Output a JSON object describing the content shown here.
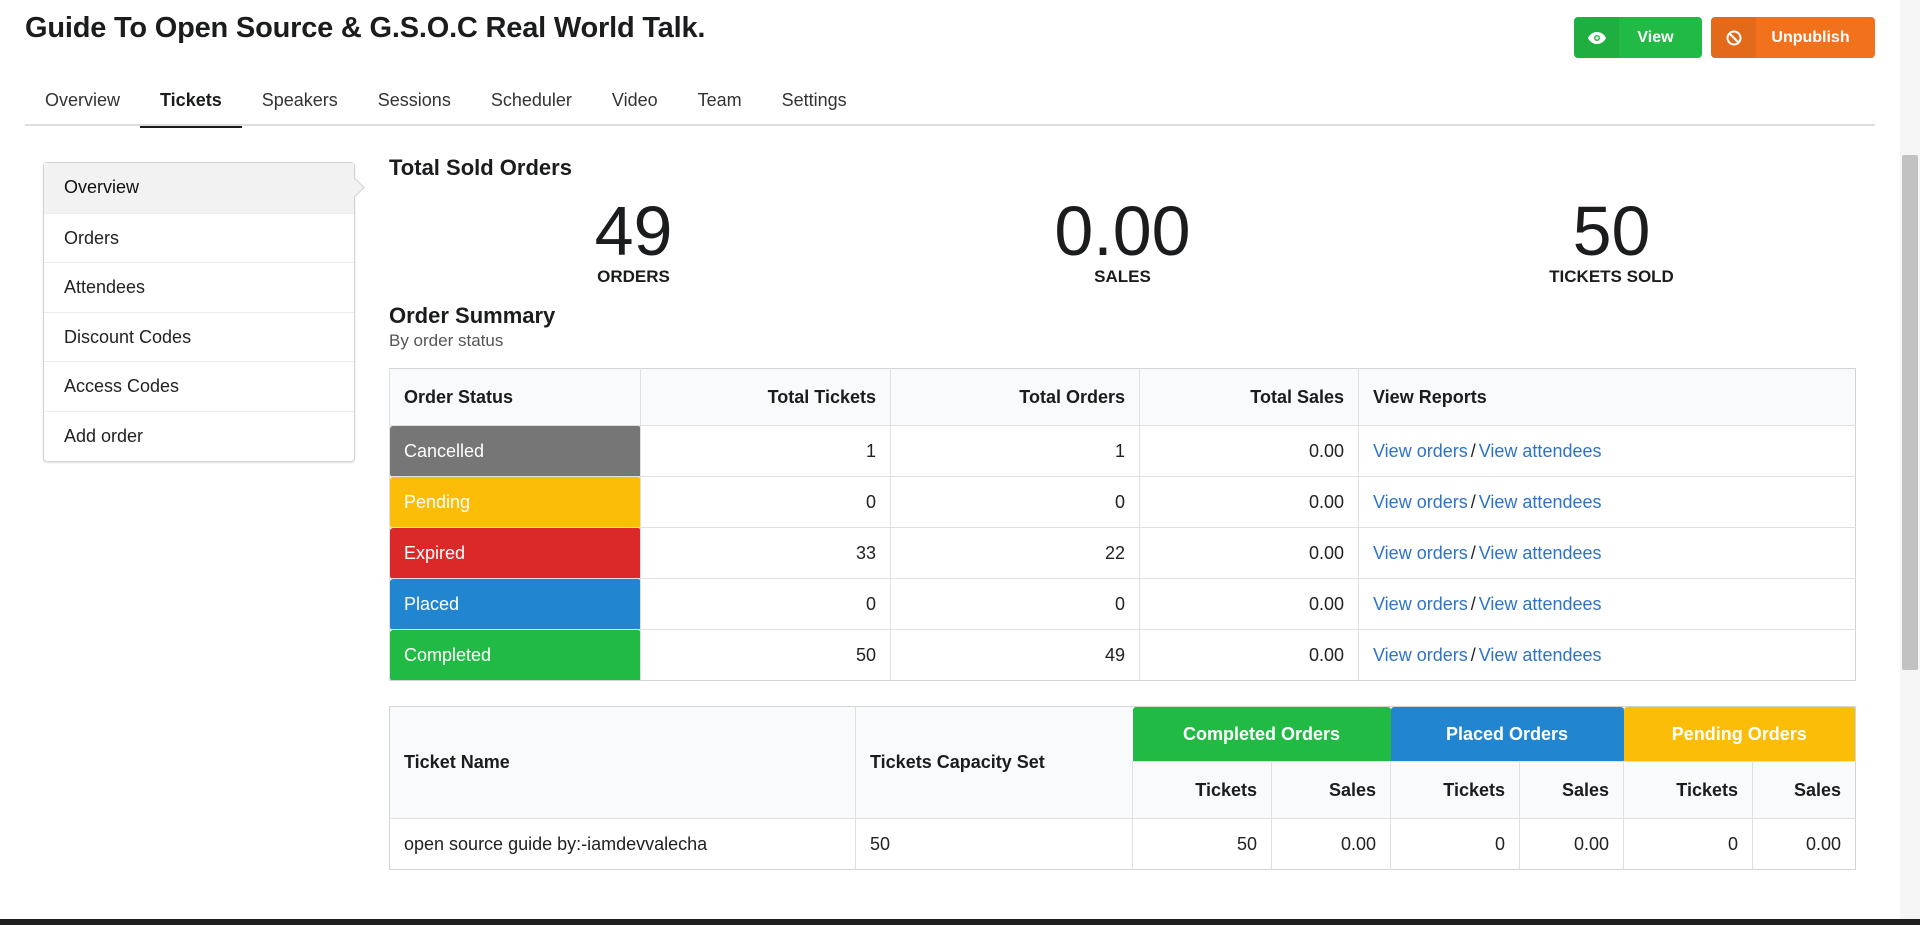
{
  "event_title": "Guide To Open Source & G.S.O.C Real World Talk.",
  "actions": {
    "view_label": "View",
    "unpublish_label": "Unpublish"
  },
  "tabs": [
    "Overview",
    "Tickets",
    "Speakers",
    "Sessions",
    "Scheduler",
    "Video",
    "Team",
    "Settings"
  ],
  "active_tab": "Tickets",
  "side_menu": [
    "Overview",
    "Orders",
    "Attendees",
    "Discount Codes",
    "Access Codes",
    "Add order"
  ],
  "sold": {
    "title": "Total Sold Orders",
    "stats": [
      {
        "value": "49",
        "label": "ORDERS"
      },
      {
        "value": "0.00",
        "label": "SALES"
      },
      {
        "value": "50",
        "label": "TICKETS SOLD"
      }
    ]
  },
  "summary": {
    "title": "Order Summary",
    "subtitle": "By order status",
    "headers": [
      "Order Status",
      "Total Tickets",
      "Total Orders",
      "Total Sales",
      "View Reports"
    ],
    "view_orders": "View orders",
    "separator": "/",
    "view_attendees": "View attendees",
    "rows": [
      {
        "status": "Cancelled",
        "color": "#767676",
        "tickets": "1",
        "orders": "1",
        "sales": "0.00"
      },
      {
        "status": "Pending",
        "color": "#fbbd08",
        "tickets": "0",
        "orders": "0",
        "sales": "0.00"
      },
      {
        "status": "Expired",
        "color": "#db2828",
        "tickets": "33",
        "orders": "22",
        "sales": "0.00"
      },
      {
        "status": "Placed",
        "color": "#2185d0",
        "tickets": "0",
        "orders": "0",
        "sales": "0.00"
      },
      {
        "status": "Completed",
        "color": "#21ba45",
        "tickets": "50",
        "orders": "49",
        "sales": "0.00"
      }
    ]
  },
  "tickets_table": {
    "ticket_name_header": "Ticket Name",
    "capacity_header": "Tickets Capacity Set",
    "groups": [
      {
        "label": "Completed Orders",
        "color": "#21ba45"
      },
      {
        "label": "Placed Orders",
        "color": "#2185d0"
      },
      {
        "label": "Pending Orders",
        "color": "#fbbd08"
      }
    ],
    "sub_tickets": "Tickets",
    "sub_sales": "Sales",
    "rows": [
      {
        "name": "open source guide by:-iamdevvalecha",
        "capacity": "50",
        "completed_tickets": "50",
        "completed_sales": "0.00",
        "placed_tickets": "0",
        "placed_sales": "0.00",
        "pending_tickets": "0",
        "pending_sales": "0.00"
      }
    ]
  }
}
